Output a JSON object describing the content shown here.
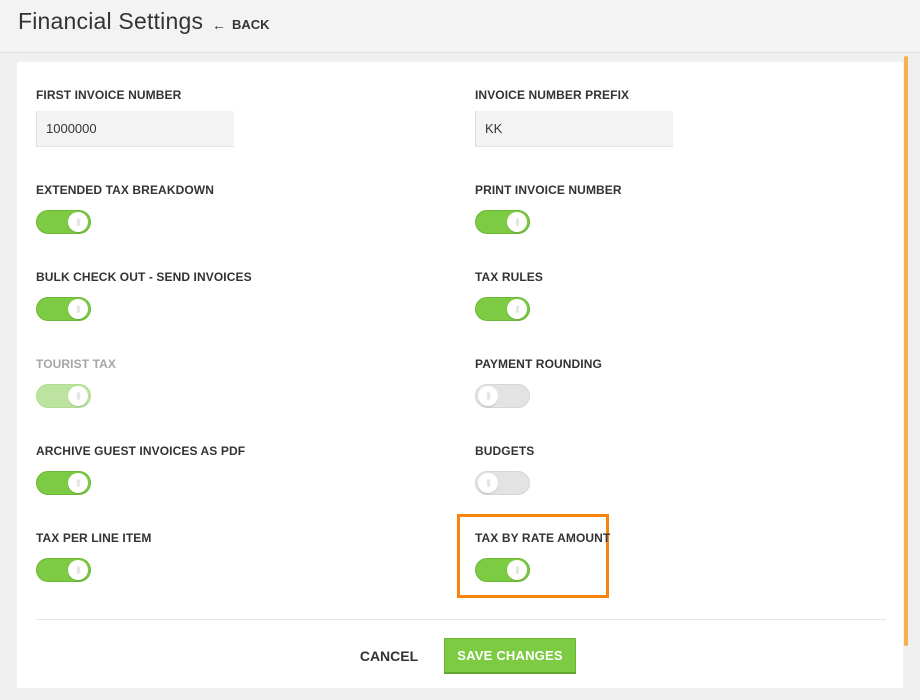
{
  "header": {
    "title": "Financial Settings",
    "back_label": "BACK",
    "back_icon": "left-arrow-icon"
  },
  "fields": {
    "first_invoice_number": {
      "label": "FIRST INVOICE NUMBER",
      "value": "1000000"
    },
    "invoice_number_prefix": {
      "label": "INVOICE NUMBER PREFIX",
      "value": "KK"
    }
  },
  "toggles": {
    "extended_tax_breakdown": {
      "label": "EXTENDED TAX BREAKDOWN",
      "on": true,
      "disabled": false
    },
    "print_invoice_number": {
      "label": "PRINT INVOICE NUMBER",
      "on": true,
      "disabled": false
    },
    "bulk_check_out": {
      "label": "BULK CHECK OUT - SEND INVOICES",
      "on": true,
      "disabled": false
    },
    "tax_rules": {
      "label": "TAX RULES",
      "on": true,
      "disabled": false
    },
    "tourist_tax": {
      "label": "TOURIST TAX",
      "on": true,
      "disabled": true
    },
    "payment_rounding": {
      "label": "PAYMENT ROUNDING",
      "on": false,
      "disabled": false
    },
    "archive_guest_invoices": {
      "label": "ARCHIVE GUEST INVOICES AS PDF",
      "on": true,
      "disabled": false
    },
    "budgets": {
      "label": "BUDGETS",
      "on": false,
      "disabled": false
    },
    "tax_per_line_item": {
      "label": "TAX PER LINE ITEM",
      "on": true,
      "disabled": false
    },
    "tax_by_rate_amount": {
      "label": "TAX BY RATE AMOUNT",
      "on": true,
      "disabled": false
    }
  },
  "footer": {
    "cancel_label": "CANCEL",
    "save_label": "SAVE CHANGES"
  },
  "colors": {
    "toggle_on": "#7ccb43",
    "toggle_off": "#e3e3e3",
    "highlight": "#f7840f",
    "scroll_accent": "#f5b14a"
  }
}
